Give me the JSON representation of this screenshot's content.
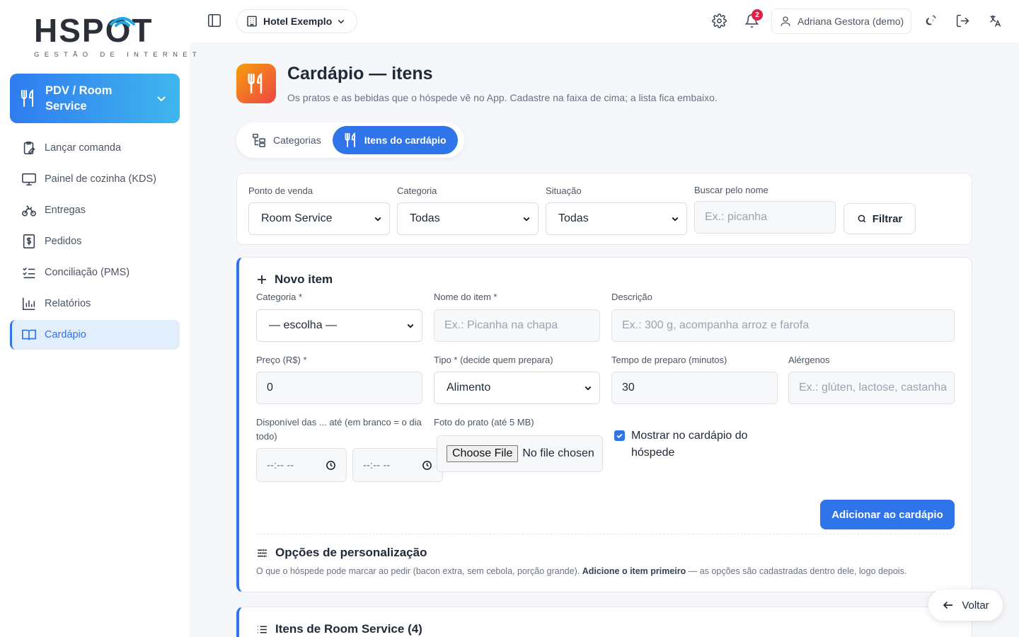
{
  "brand": {
    "logo_text": "HSPOT",
    "logo_tagline": "GESTÃO DE INTERNET",
    "accent": "#2f74e8"
  },
  "sidebar": {
    "module": {
      "label": "PDV / Room Service",
      "icon": "fork-knife-icon"
    },
    "items": [
      {
        "label": "Lançar comanda",
        "icon": "clipboard-edit-icon"
      },
      {
        "label": "Painel de cozinha (KDS)",
        "icon": "monitor-icon"
      },
      {
        "label": "Entregas",
        "icon": "bike-icon"
      },
      {
        "label": "Pedidos",
        "icon": "receipt-icon"
      },
      {
        "label": "Conciliação (PMS)",
        "icon": "checklist-icon"
      },
      {
        "label": "Relatórios",
        "icon": "bar-chart-icon"
      },
      {
        "label": "Cardápio",
        "icon": "book-open-icon",
        "active": true
      }
    ]
  },
  "topbar": {
    "hotel": "Hotel Exemplo",
    "notifications_count": "2",
    "user": "Adriana Gestora (demo)"
  },
  "page": {
    "title": "Cardápio — itens",
    "subtitle": "Os pratos e as bebidas que o hóspede vê no App. Cadastre na faixa de cima; a lista fica embaixo."
  },
  "tabs": [
    {
      "label": "Categorias",
      "active": false
    },
    {
      "label": "Itens do cardápio",
      "active": true
    }
  ],
  "filters": {
    "pos": {
      "label": "Ponto de venda",
      "value": "Room Service"
    },
    "category": {
      "label": "Categoria",
      "value": "Todas"
    },
    "status": {
      "label": "Situação",
      "value": "Todas"
    },
    "search": {
      "label": "Buscar pelo nome",
      "placeholder": "Ex.: picanha"
    },
    "button": "Filtrar"
  },
  "new_item": {
    "title": "Novo item",
    "category": {
      "label": "Categoria *",
      "value": "— escolha —"
    },
    "name": {
      "label": "Nome do item *",
      "placeholder": "Ex.: Picanha na chapa"
    },
    "description": {
      "label": "Descrição",
      "placeholder": "Ex.: 300 g, acompanha arroz e farofa"
    },
    "price": {
      "label": "Preço (R$) *",
      "value": "0"
    },
    "type": {
      "label": "Tipo * (decide quem prepara)",
      "value": "Alimento"
    },
    "prep_time": {
      "label": "Tempo de preparo (minutos)",
      "value": "30"
    },
    "allergens": {
      "label": "Alérgenos",
      "placeholder": "Ex.: glúten, lactose, castanha"
    },
    "availability": {
      "label": "Disponível das ... até (em branco = o dia todo)",
      "from": "--:-- --",
      "to": "--:-- --"
    },
    "photo": {
      "label": "Foto do prato (até 5 MB)",
      "button": "Choose File",
      "status": "No file chosen"
    },
    "show_in_menu": {
      "label": "Mostrar no cardápio do hóspede",
      "checked": true
    },
    "submit": "Adicionar ao cardápio"
  },
  "options": {
    "title": "Opções de personalização",
    "desc_1": "O que o hóspede pode marcar ao pedir (bacon extra, sem cebola, porção grande).",
    "desc_bold": "Adicione o item primeiro",
    "desc_2": "— as opções são cadastradas dentro dele, logo depois."
  },
  "list": {
    "title": "Itens de Room Service (4)"
  },
  "back_button": "Voltar"
}
